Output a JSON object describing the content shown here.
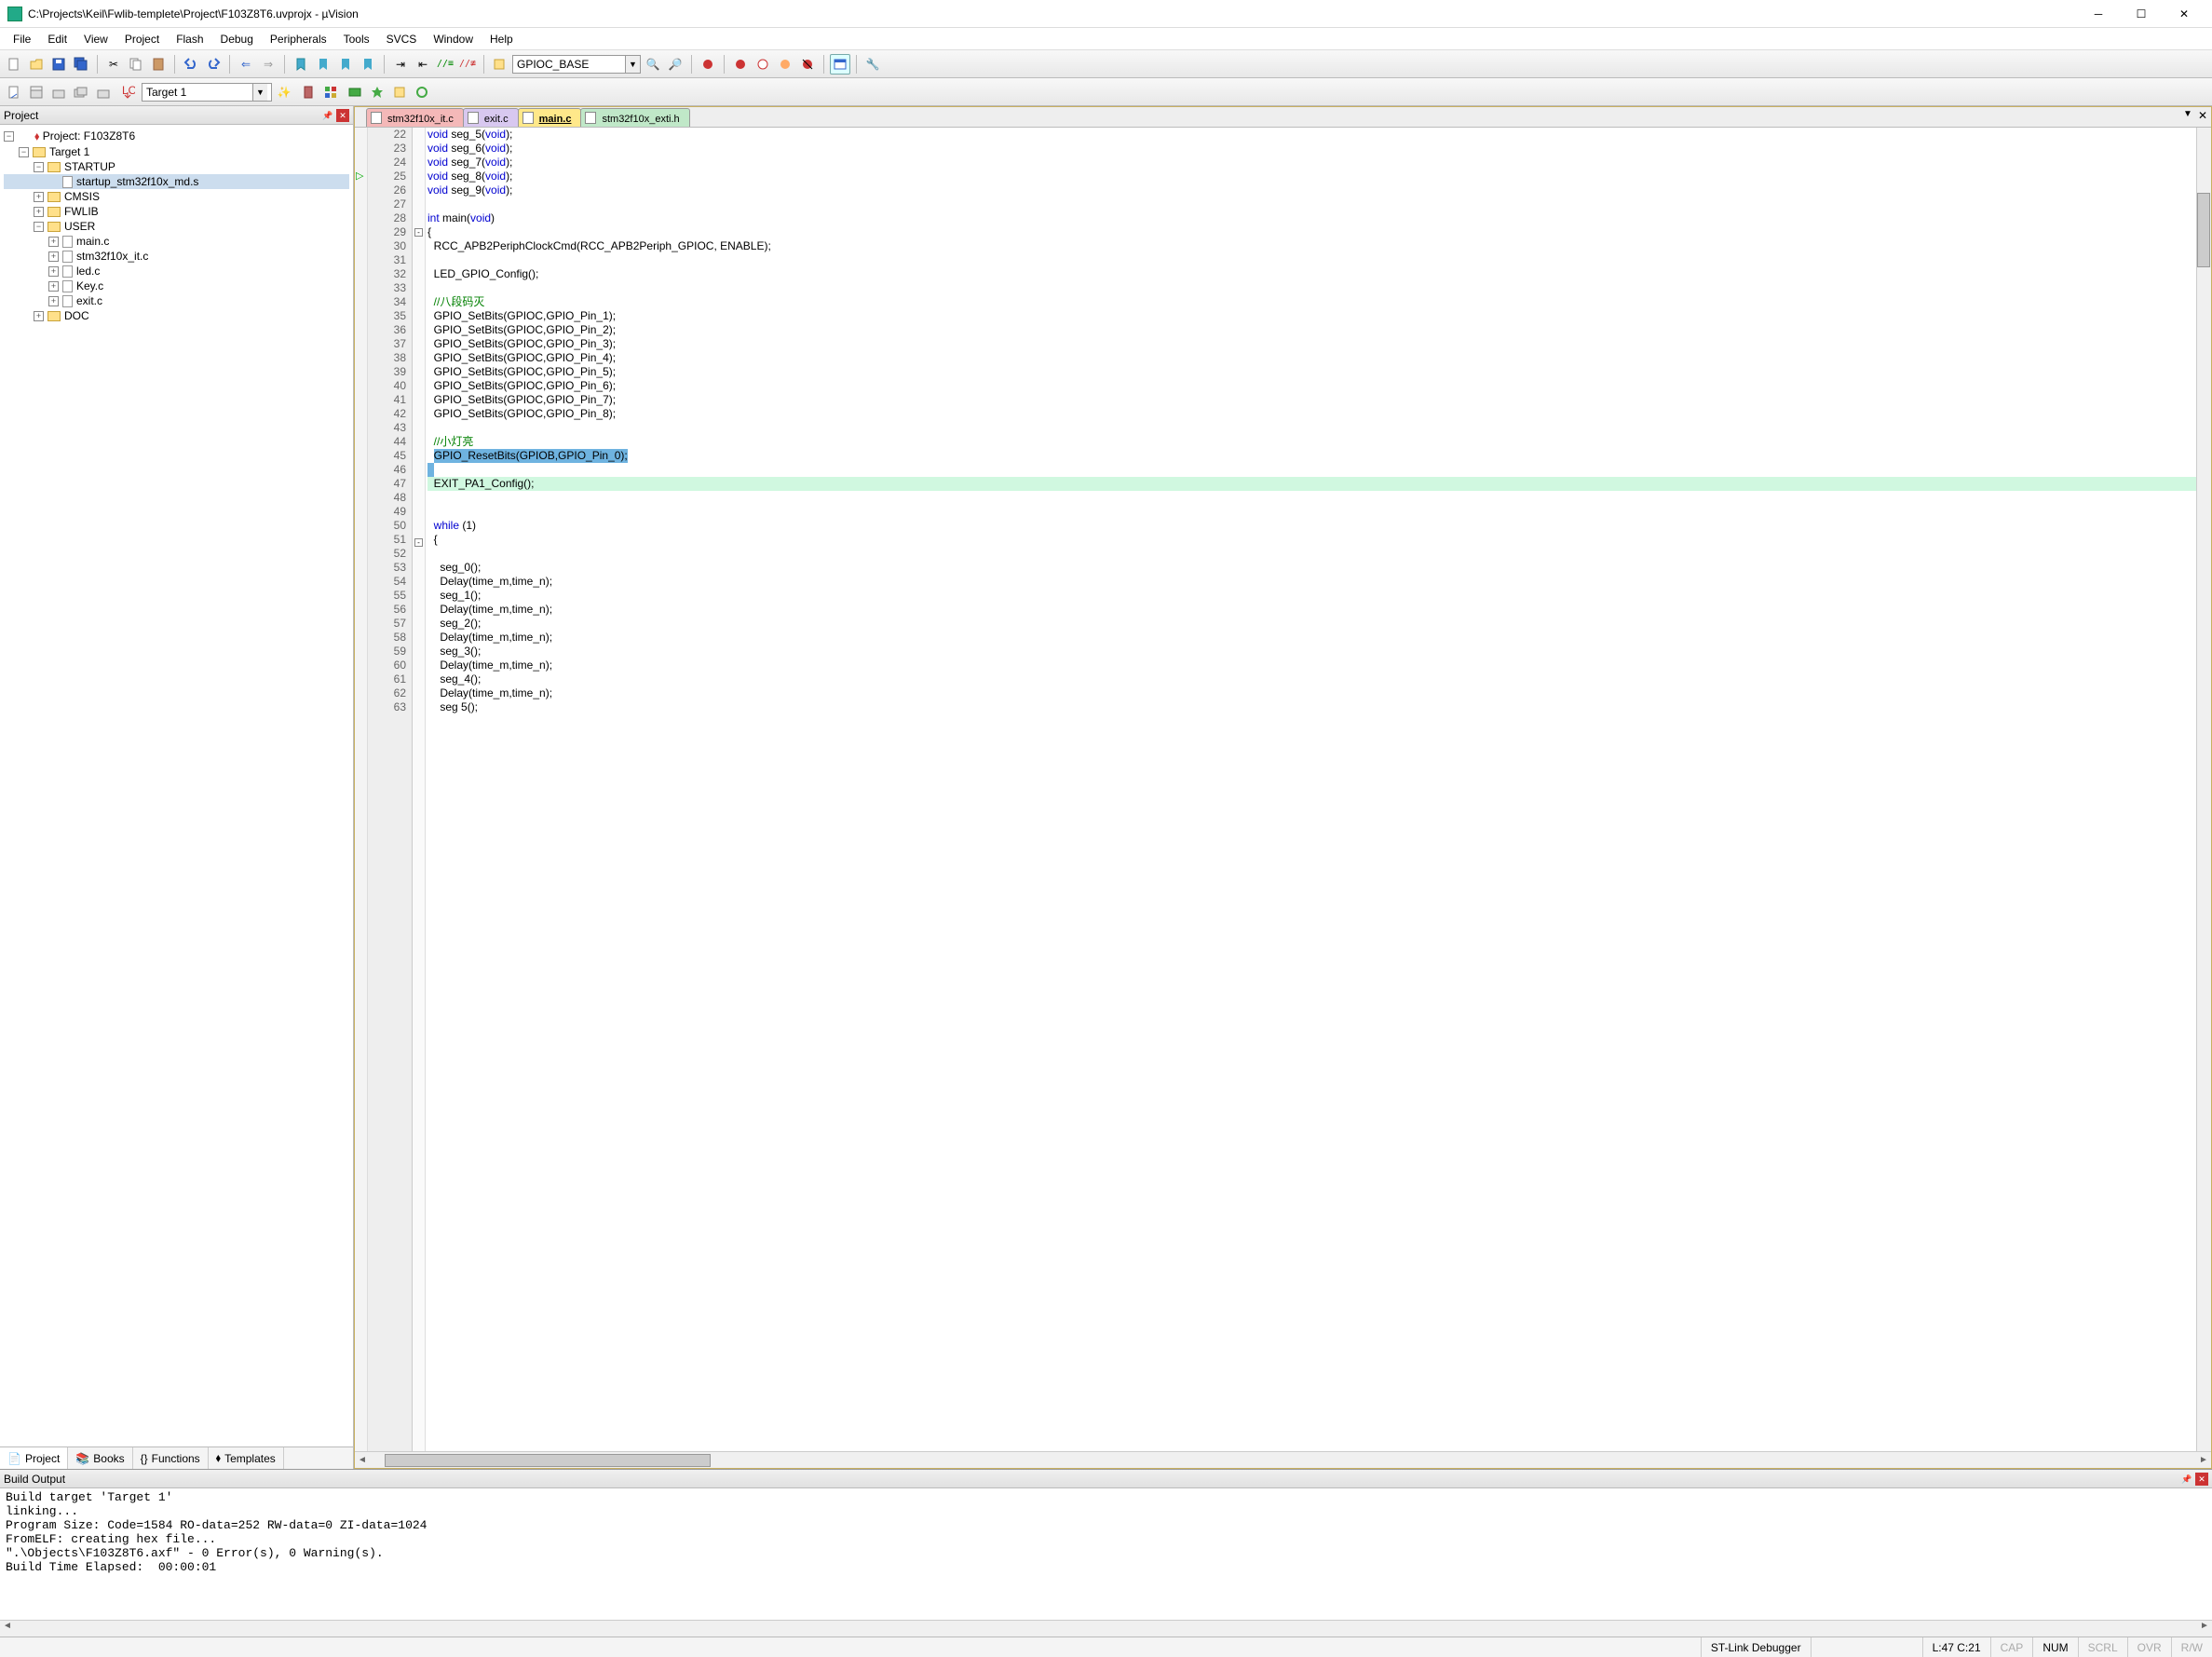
{
  "window": {
    "title": "C:\\Projects\\Keil\\Fwlib-templete\\Project\\F103Z8T6.uvprojx - µVision"
  },
  "menus": [
    "File",
    "Edit",
    "View",
    "Project",
    "Flash",
    "Debug",
    "Peripherals",
    "Tools",
    "SVCS",
    "Window",
    "Help"
  ],
  "search_combo": "GPIOC_BASE",
  "target_combo": "Target 1",
  "project_panel": {
    "title": "Project",
    "tree": {
      "root": "Project: F103Z8T6",
      "target": "Target 1",
      "groups": [
        {
          "name": "STARTUP",
          "children": [
            "startup_stm32f10x_md.s"
          ],
          "expanded": true
        },
        {
          "name": "CMSIS",
          "children": [],
          "expanded": false
        },
        {
          "name": "FWLIB",
          "children": [],
          "expanded": false
        },
        {
          "name": "USER",
          "children": [
            "main.c",
            "stm32f10x_it.c",
            "led.c",
            "Key.c",
            "exit.c"
          ],
          "expanded": true
        },
        {
          "name": "DOC",
          "children": [],
          "expanded": false
        }
      ],
      "selected": "startup_stm32f10x_md.s"
    },
    "tabs": [
      "Project",
      "Books",
      "Functions",
      "Templates"
    ]
  },
  "editor": {
    "tabs": [
      {
        "label": "stm32f10x_it.c",
        "color": "red"
      },
      {
        "label": "exit.c",
        "color": "purple"
      },
      {
        "label": "main.c",
        "color": "yellow",
        "active": true
      },
      {
        "label": "stm32f10x_exti.h",
        "color": "green"
      }
    ],
    "first_line": 22,
    "lines": [
      {
        "n": 22,
        "html": "<span class='kw'>void</span> seg_5(<span class='kw'>void</span>);"
      },
      {
        "n": 23,
        "html": "<span class='kw'>void</span> seg_6(<span class='kw'>void</span>);"
      },
      {
        "n": 24,
        "html": "<span class='kw'>void</span> seg_7(<span class='kw'>void</span>);"
      },
      {
        "n": 25,
        "html": "<span class='kw'>void</span> seg_8(<span class='kw'>void</span>);"
      },
      {
        "n": 26,
        "html": "<span class='kw'>void</span> seg_9(<span class='kw'>void</span>);"
      },
      {
        "n": 27,
        "html": ""
      },
      {
        "n": 28,
        "html": "<span class='kw'>int</span> main(<span class='kw'>void</span>)"
      },
      {
        "n": 29,
        "html": "{",
        "fold": "-"
      },
      {
        "n": 30,
        "html": "  RCC_APB2PeriphClockCmd(RCC_APB2Periph_GPIOC, ENABLE);"
      },
      {
        "n": 31,
        "html": ""
      },
      {
        "n": 32,
        "html": "  LED_GPIO_Config();"
      },
      {
        "n": 33,
        "html": ""
      },
      {
        "n": 34,
        "html": "  <span class='cmt'>//八段码灭</span>"
      },
      {
        "n": 35,
        "html": "  GPIO_SetBits(GPIOC,GPIO_Pin_1);"
      },
      {
        "n": 36,
        "html": "  GPIO_SetBits(GPIOC,GPIO_Pin_2);"
      },
      {
        "n": 37,
        "html": "  GPIO_SetBits(GPIOC,GPIO_Pin_3);"
      },
      {
        "n": 38,
        "html": "  GPIO_SetBits(GPIOC,GPIO_Pin_4);"
      },
      {
        "n": 39,
        "html": "  GPIO_SetBits(GPIOC,GPIO_Pin_5);"
      },
      {
        "n": 40,
        "html": "  GPIO_SetBits(GPIOC,GPIO_Pin_6);"
      },
      {
        "n": 41,
        "html": "  GPIO_SetBits(GPIOC,GPIO_Pin_7);"
      },
      {
        "n": 42,
        "html": "  GPIO_SetBits(GPIOC,GPIO_Pin_8);"
      },
      {
        "n": 43,
        "html": ""
      },
      {
        "n": 44,
        "html": "  <span class='cmt'>//小灯亮</span>"
      },
      {
        "n": 45,
        "html": "  <span class='hl-sel'>GPIO_ResetBits(GPIOB,GPIO_Pin_0);</span>",
        "sel": true
      },
      {
        "n": 46,
        "html": "<span class='hl-sel'>  </span>",
        "sel": true
      },
      {
        "n": 47,
        "html": "  EXIT_PA1_Config();",
        "curr": true
      },
      {
        "n": 48,
        "html": ""
      },
      {
        "n": 49,
        "html": ""
      },
      {
        "n": 50,
        "html": "  <span class='kw'>while</span> (1)"
      },
      {
        "n": 51,
        "html": "  {",
        "fold": "-"
      },
      {
        "n": 52,
        "html": ""
      },
      {
        "n": 53,
        "html": "    seg_0();"
      },
      {
        "n": 54,
        "html": "    Delay(time_m,time_n);"
      },
      {
        "n": 55,
        "html": "    seg_1();"
      },
      {
        "n": 56,
        "html": "    Delay(time_m,time_n);"
      },
      {
        "n": 57,
        "html": "    seg_2();"
      },
      {
        "n": 58,
        "html": "    Delay(time_m,time_n);"
      },
      {
        "n": 59,
        "html": "    seg_3();"
      },
      {
        "n": 60,
        "html": "    Delay(time_m,time_n);"
      },
      {
        "n": 61,
        "html": "    seg_4();"
      },
      {
        "n": 62,
        "html": "    Delay(time_m,time_n);"
      },
      {
        "n": 63,
        "html": "    seg 5();"
      }
    ]
  },
  "build_output": {
    "title": "Build Output",
    "lines": [
      "Build target 'Target 1'",
      "linking...",
      "Program Size: Code=1584 RO-data=252 RW-data=0 ZI-data=1024",
      "FromELF: creating hex file...",
      "\".\\Objects\\F103Z8T6.axf\" - 0 Error(s), 0 Warning(s).",
      "Build Time Elapsed:  00:00:01"
    ]
  },
  "status": {
    "debugger": "ST-Link Debugger",
    "pos": "L:47 C:21",
    "caps": "CAP",
    "num": "NUM",
    "scrl": "SCRL",
    "ovr": "OVR",
    "rw": "R/W"
  }
}
